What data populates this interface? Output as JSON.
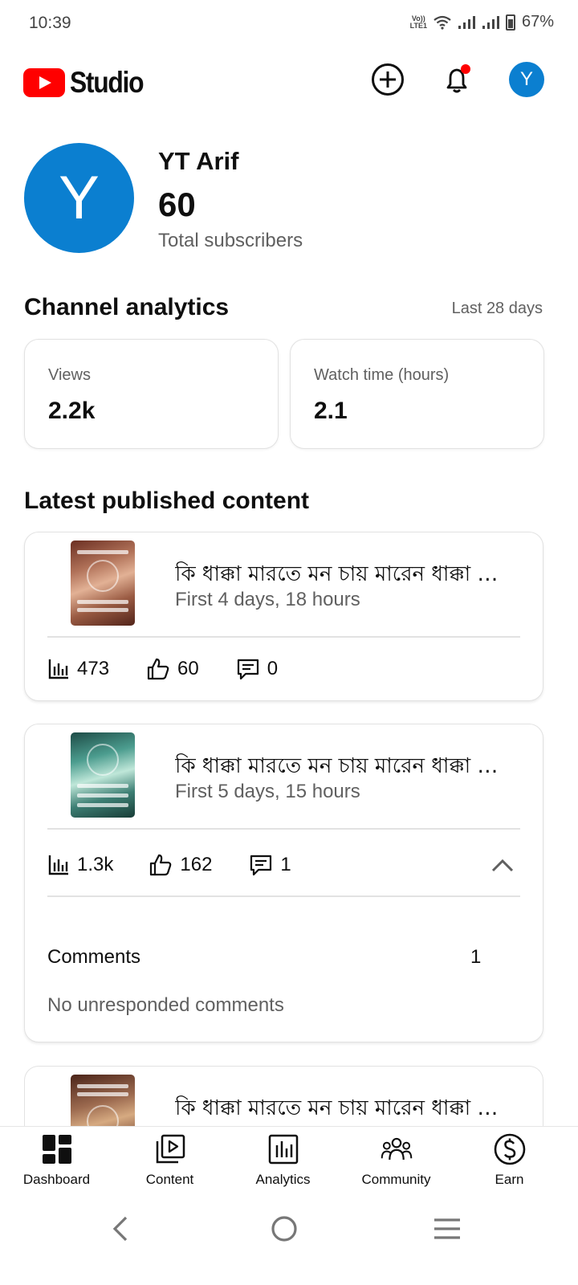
{
  "status_bar": {
    "time": "10:39",
    "network_top": "Vo))",
    "network_bottom": "LTE1",
    "battery": "67%"
  },
  "header": {
    "app_name": "Studio",
    "avatar_letter": "Y",
    "notification_dot_color": "#ff0000"
  },
  "channel": {
    "avatar_letter": "Y",
    "name": "YT Arif",
    "subscribers": "60",
    "subscribers_label": "Total subscribers"
  },
  "analytics": {
    "title": "Channel analytics",
    "period": "Last 28 days",
    "cards": [
      {
        "label": "Views",
        "value": "2.2k"
      },
      {
        "label": "Watch time (hours)",
        "value": "2.1"
      }
    ]
  },
  "latest": {
    "title": "Latest published content",
    "videos": [
      {
        "title": "কি ধাক্কা মারতে মন চায় মারেন ধাক্কা 😭...",
        "age": "First 4 days, 18 hours",
        "views": "473",
        "likes": "60",
        "comments": "0"
      },
      {
        "title": "কি ধাক্কা মারতে মন চায় মারেন ধাক্কা 😭...",
        "age": "First 5 days, 15 hours",
        "views": "1.3k",
        "likes": "162",
        "comments": "1",
        "expanded": {
          "comments_label": "Comments",
          "comments_count": "1",
          "status": "No unresponded comments"
        }
      },
      {
        "title": "কি ধাক্কা মারতে মন চায় মারেন ধাক্কা 😭..."
      }
    ]
  },
  "bottom_nav": [
    {
      "label": "Dashboard",
      "icon": "dashboard-icon",
      "active": true
    },
    {
      "label": "Content",
      "icon": "content-icon"
    },
    {
      "label": "Analytics",
      "icon": "analytics-icon"
    },
    {
      "label": "Community",
      "icon": "community-icon"
    },
    {
      "label": "Earn",
      "icon": "earn-icon"
    }
  ],
  "colors": {
    "brand_red": "#ff0000",
    "avatar_blue": "#0b7fd0",
    "secondary_text": "#606060"
  }
}
